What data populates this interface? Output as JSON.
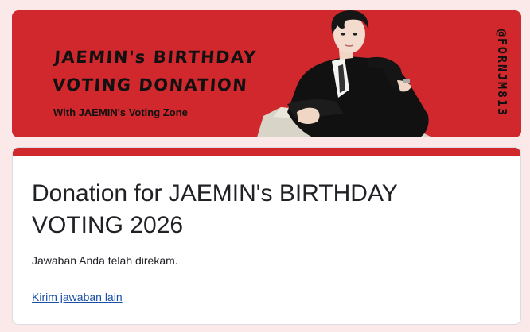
{
  "banner": {
    "title_line1": "JAEMIN's BIRTHDAY",
    "title_line2": "VOTING DONATION",
    "subtitle": "With JAEMIN's Voting Zone",
    "handle": "@FORNJM813"
  },
  "form": {
    "title": "Donation for JAEMIN's BIRTHDAY VOTING 2026",
    "confirmation_message": "Jawaban Anda telah direkam.",
    "submit_another_link": "Kirim jawaban lain"
  },
  "colors": {
    "accent": "#d1282d",
    "page_background": "#fbe9e9",
    "link": "#1a4fa8"
  }
}
